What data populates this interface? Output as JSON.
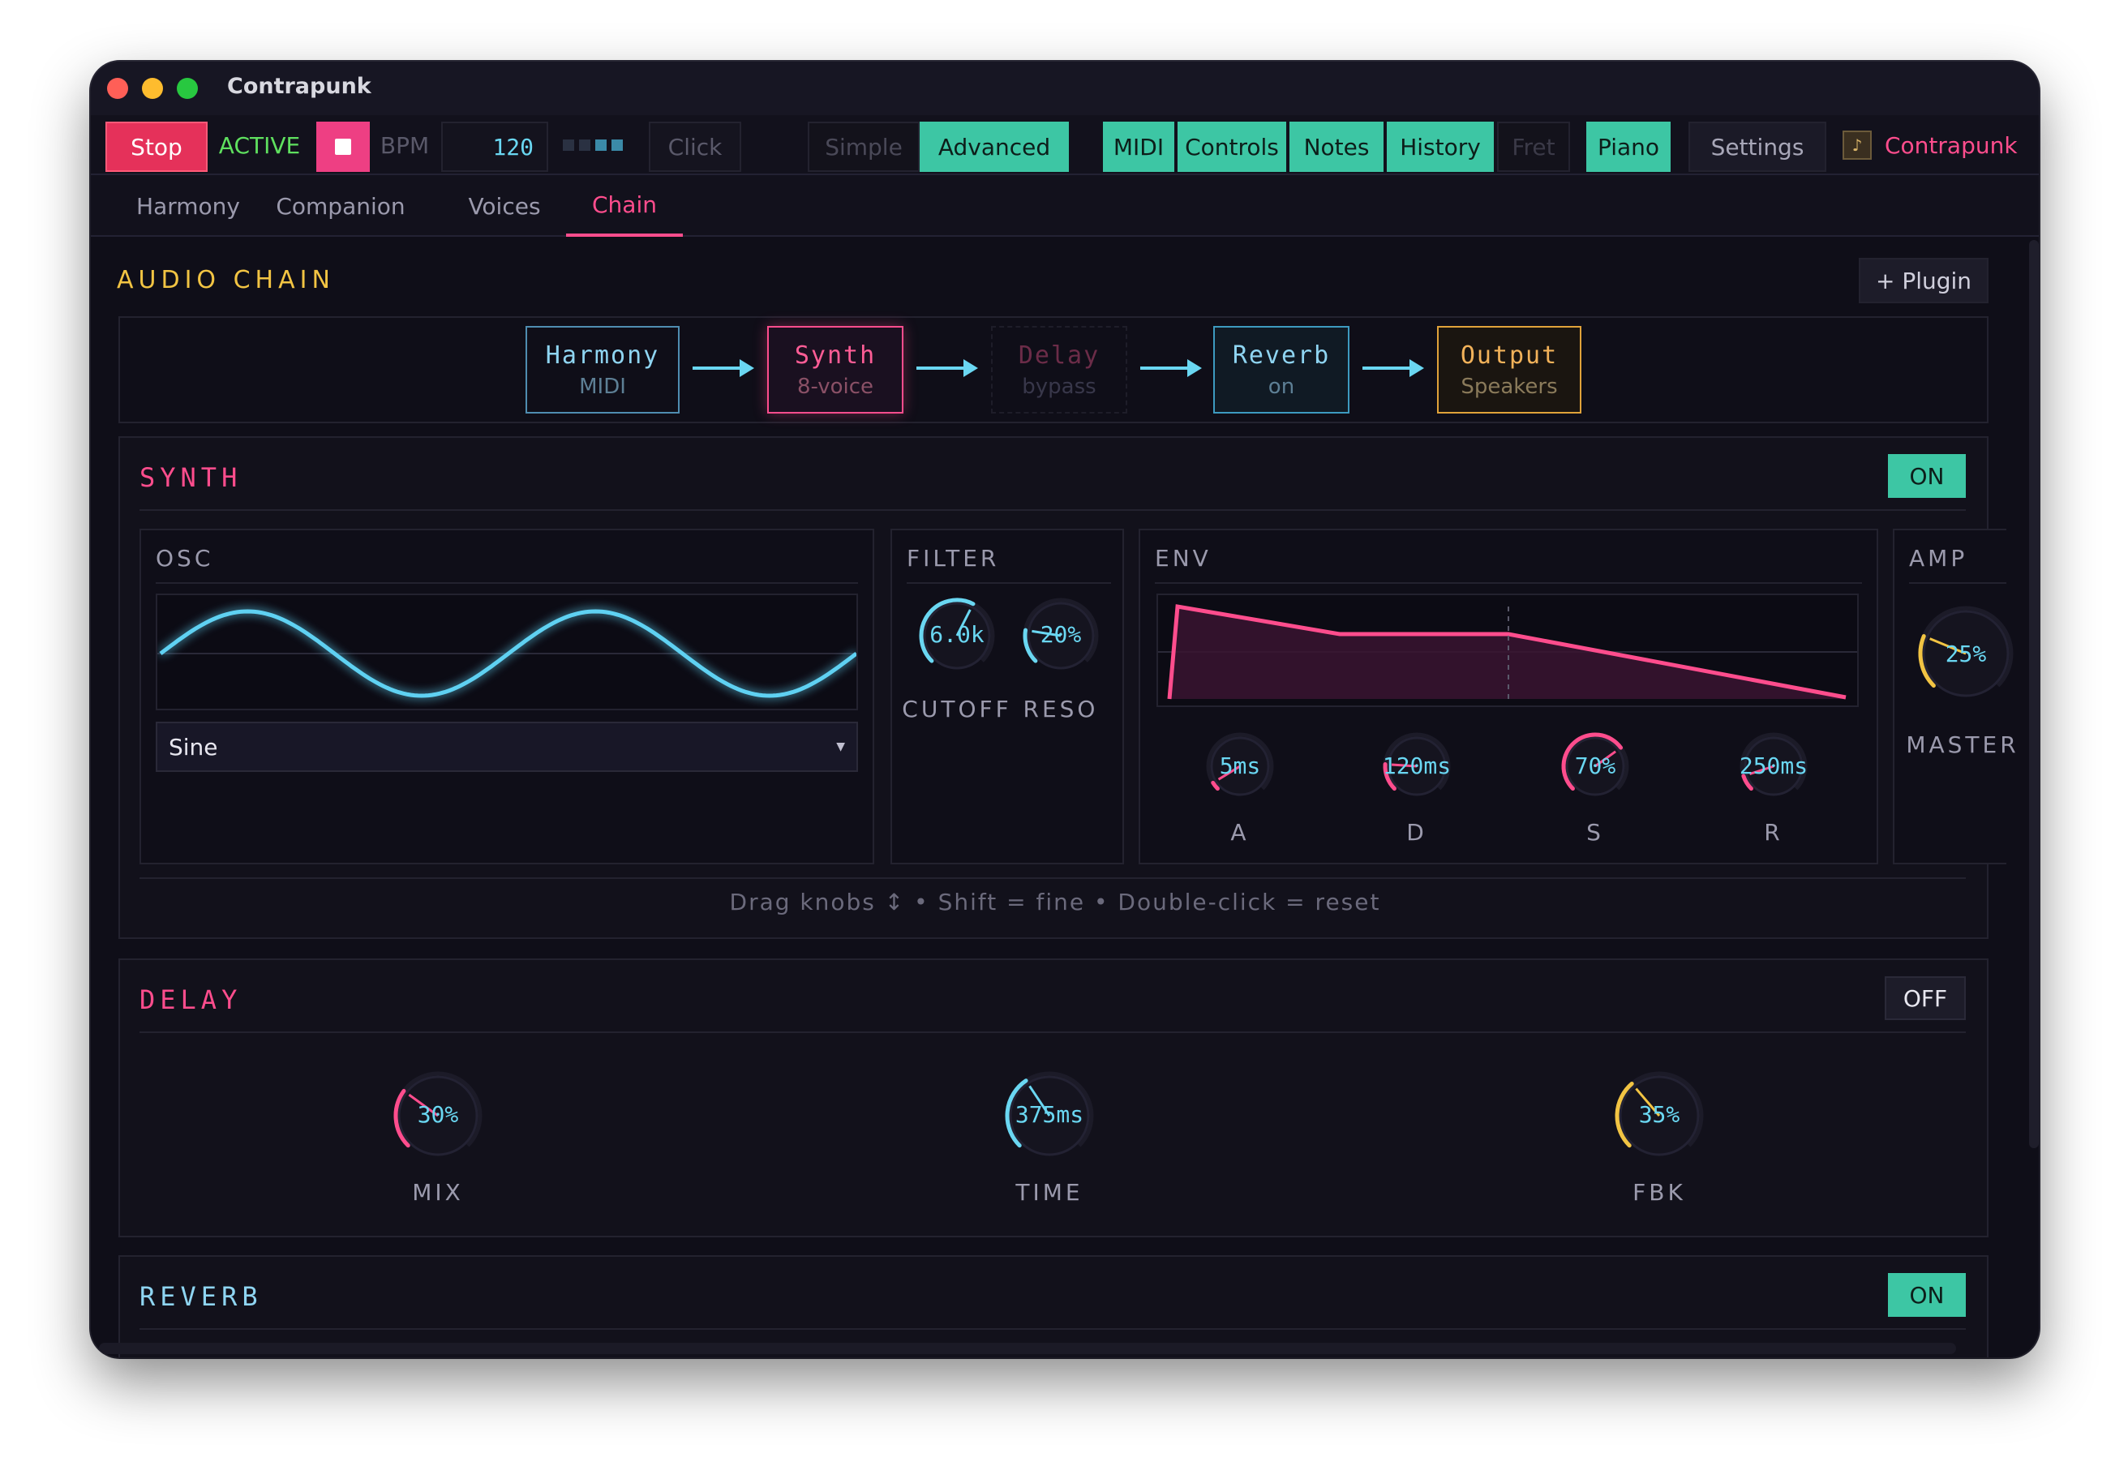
{
  "app": {
    "title": "Contrapunk"
  },
  "toolbar": {
    "stop_label": "Stop",
    "status_label": "ACTIVE",
    "bpm_label": "BPM",
    "bpm_value": "120",
    "click_label": "Click",
    "mode_simple": "Simple",
    "mode_advanced": "Advanced",
    "panels": [
      "MIDI",
      "Controls",
      "Notes",
      "History",
      "Fret",
      "Piano"
    ],
    "settings_label": "Settings",
    "brand_label": "Contrapunk"
  },
  "tabs": [
    "Harmony",
    "Companion",
    "Voices",
    "Chain"
  ],
  "audio_chain": {
    "title": "AUDIO CHAIN",
    "add_plugin_label": "+ Plugin",
    "nodes": [
      {
        "name": "Harmony",
        "sub": "MIDI"
      },
      {
        "name": "Synth",
        "sub": "8-voice"
      },
      {
        "name": "Delay",
        "sub": "bypass"
      },
      {
        "name": "Reverb",
        "sub": "on"
      },
      {
        "name": "Output",
        "sub": "Speakers"
      }
    ]
  },
  "synth": {
    "title": "SYNTH",
    "toggle": "ON",
    "osc": {
      "label": "OSC",
      "waveform": "Sine"
    },
    "filter": {
      "label": "FILTER",
      "cutoff": {
        "value": "6.0k",
        "label": "CUTOFF"
      },
      "reso": {
        "value": "20%",
        "label": "RESO"
      }
    },
    "env": {
      "label": "ENV",
      "a": {
        "value": "5ms",
        "label": "A"
      },
      "d": {
        "value": "120ms",
        "label": "D"
      },
      "s": {
        "value": "70%",
        "label": "S"
      },
      "r": {
        "value": "250ms",
        "label": "R"
      }
    },
    "amp": {
      "label": "AMP",
      "master": {
        "value": "25%",
        "label": "MASTER"
      }
    },
    "hint": "Drag knobs ↕ • Shift = fine • Double-click = reset"
  },
  "delay": {
    "title": "DELAY",
    "toggle": "OFF",
    "mix": {
      "value": "30%",
      "label": "MIX"
    },
    "time": {
      "value": "375ms",
      "label": "TIME"
    },
    "fbk": {
      "value": "35%",
      "label": "FBK"
    }
  },
  "reverb": {
    "title": "REVERB",
    "toggle": "ON"
  },
  "colors": {
    "pink": "#ff4d8d",
    "teal": "#3dc6a4",
    "cyan": "#6ad7f2",
    "amber": "#f2c443",
    "bg": "#0f0e18"
  }
}
